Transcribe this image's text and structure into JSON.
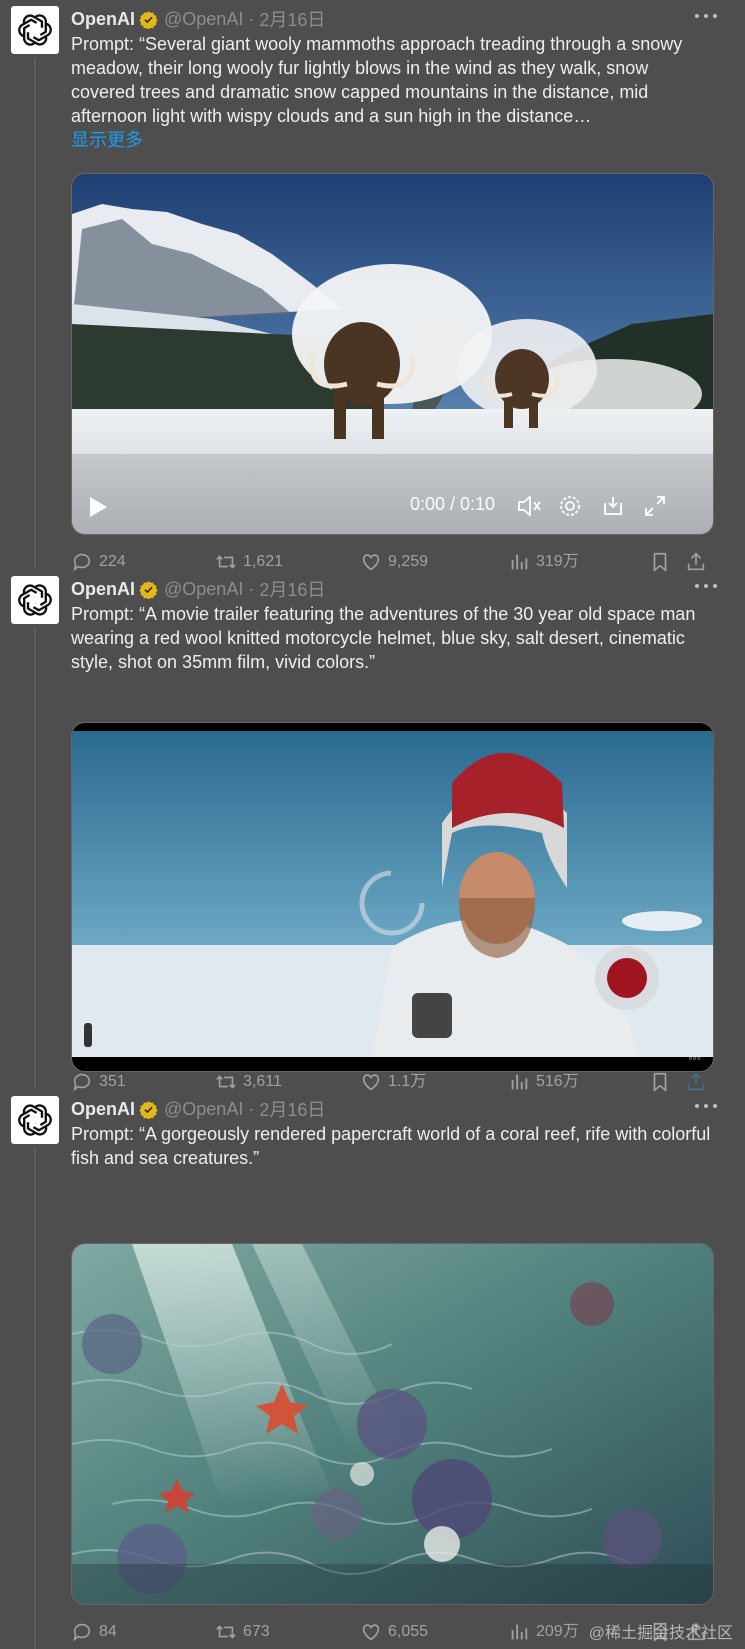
{
  "tweets": [
    {
      "name": "OpenAI",
      "handle": "@OpenAI",
      "date": "2月16日",
      "text": "Prompt: “Several giant wooly mammoths approach treading through a snowy meadow, their long wooly fur lightly blows in the wind as they walk, snow covered trees and dramatic snow capped mountains in the distance, mid afternoon light with wispy clouds and a sun high in the distance…",
      "show_more": "显示更多",
      "video_time": "0:00 / 0:10",
      "replies": "224",
      "retweets": "1,621",
      "likes": "9,259",
      "views": "319万"
    },
    {
      "name": "OpenAI",
      "handle": "@OpenAI",
      "date": "2月16日",
      "text": "Prompt: “A movie trailer featuring the adventures of the 30 year old space man wearing a red wool knitted motorcycle helmet, blue sky, salt desert, cinematic style, shot on 35mm film, vivid colors.”",
      "replies": "351",
      "retweets": "3,611",
      "likes": "1.1万",
      "views": "516万"
    },
    {
      "name": "OpenAI",
      "handle": "@OpenAI",
      "date": "2月16日",
      "text": "Prompt: “A gorgeously rendered papercraft world of a coral reef, rife with colorful fish and sea creatures.”",
      "replies": "84",
      "retweets": "673",
      "likes": "6,055",
      "views": "209万"
    }
  ],
  "watermark": "@稀土掘金技术社区",
  "colors": {
    "background": "#4e4e4f",
    "link": "#1d9bf0",
    "verified_badge": "#e2b719"
  },
  "icons": [
    "openai-logo-icon",
    "verified-badge-icon",
    "more-icon",
    "reply-icon",
    "retweet-icon",
    "like-icon",
    "views-icon",
    "bookmark-icon",
    "share-icon",
    "play-icon",
    "mute-icon",
    "settings-icon",
    "pip-icon",
    "fullscreen-icon",
    "loading-spinner-icon"
  ]
}
